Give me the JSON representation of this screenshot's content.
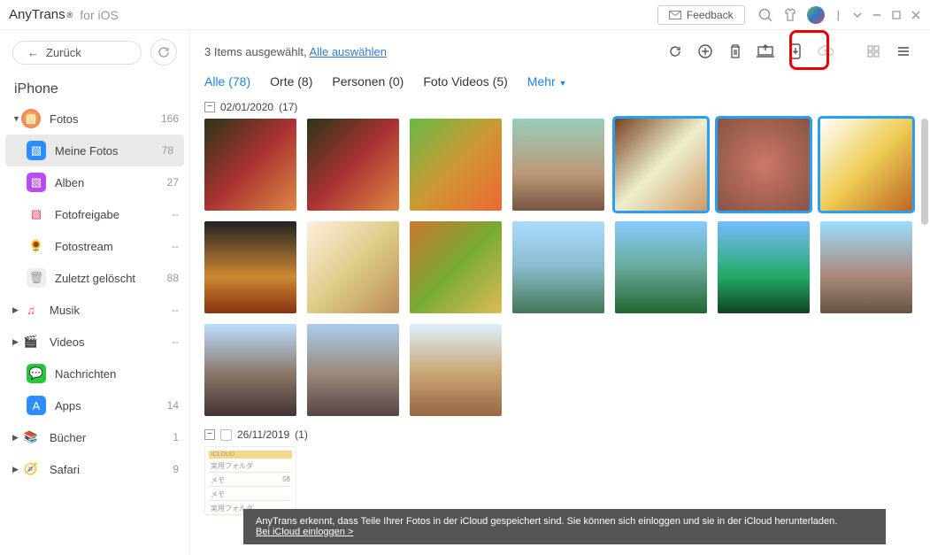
{
  "title": {
    "app": "AnyTrans",
    "suffix": "for iOS"
  },
  "feedback": "Feedback",
  "back": "Zurück",
  "device": "iPhone",
  "sidebar": [
    {
      "label": "Fotos",
      "count": "166",
      "root": true,
      "color": "radial-gradient(circle,#fd5,#e55)",
      "caret": "▼"
    },
    {
      "label": "Meine Fotos",
      "count": "78",
      "child": true,
      "active": true,
      "bg": "#2d8cff"
    },
    {
      "label": "Alben",
      "count": "27",
      "child": true,
      "bg": "#b84cf0"
    },
    {
      "label": "Fotofreigabe",
      "count": "--",
      "child": true,
      "bg": "#fff",
      "fg": "#ff445a"
    },
    {
      "label": "Fotostream",
      "count": "--",
      "child": true,
      "bg": "#fff",
      "emoji": "🌻"
    },
    {
      "label": "Zuletzt gelöscht",
      "count": "88",
      "child": true,
      "bg": "#eee",
      "fg": "#999",
      "emoji": "🗑"
    },
    {
      "label": "Musik",
      "count": "--",
      "root": true,
      "bg": "#fff",
      "fg": "#ff3967",
      "caret": "▶",
      "emoji": "♫"
    },
    {
      "label": "Videos",
      "count": "--",
      "root": true,
      "bg": "#fff",
      "caret": "▶",
      "emoji": "🎬"
    },
    {
      "label": "Nachrichten",
      "count": "",
      "child": true,
      "bg": "#28c53f",
      "emoji": "💬"
    },
    {
      "label": "Apps",
      "count": "14",
      "child": true,
      "bg": "#2d8cff",
      "emoji": "A"
    },
    {
      "label": "Bücher",
      "count": "1",
      "root": true,
      "bg": "#fff",
      "caret": "▶",
      "emoji": "📚"
    },
    {
      "label": "Safari",
      "count": "9",
      "root": true,
      "bg": "#fff",
      "caret": "▶",
      "emoji": "🧭"
    }
  ],
  "selection": {
    "text": "3 Items ausgewählt,",
    "link": "Alle auswählen"
  },
  "tabs": [
    {
      "label": "Alle (78)",
      "active": true
    },
    {
      "label": "Orte (8)"
    },
    {
      "label": "Personen (0)"
    },
    {
      "label": "Foto Videos (5)"
    }
  ],
  "more": "Mehr",
  "groups": [
    {
      "date": "02/01/2020",
      "count": "(17)",
      "thumbs": [
        {
          "g": "linear-gradient(135deg,#2a3618,#a33,#d84)"
        },
        {
          "g": "linear-gradient(135deg,#2a3618,#a33,#d84)"
        },
        {
          "g": "linear-gradient(135deg,#6b4,#c93,#e63)"
        },
        {
          "g": "linear-gradient(180deg,#9cb,#b97 60%,#754)"
        },
        {
          "g": "linear-gradient(135deg,#742,#eec,#c96)",
          "sel": true
        },
        {
          "g": "radial-gradient(circle,#c76,#854)",
          "sel": true
        },
        {
          "g": "linear-gradient(135deg,#fff,#ec5,#b62)",
          "sel": true
        },
        {
          "g": "linear-gradient(180deg,#222,#c83 60%,#831)"
        },
        {
          "g": "linear-gradient(135deg,#fed,#dc8,#b85)"
        },
        {
          "g": "linear-gradient(135deg,#c73,#7a3,#db5)"
        },
        {
          "g": "linear-gradient(180deg,#adf,#8bc 50%,#475)"
        },
        {
          "g": "linear-gradient(180deg,#8cf,#6a9 50%,#263)"
        },
        {
          "g": "linear-gradient(180deg,#7bf,#2a6 60%,#142)"
        },
        {
          "g": "linear-gradient(180deg,#9df,#a87 60%,#654)"
        },
        {
          "g": "linear-gradient(180deg,#bdf,#876 55%,#433)"
        },
        {
          "g": "linear-gradient(180deg,#ace,#987 55%,#544)"
        },
        {
          "g": "linear-gradient(180deg,#def,#ca7 50%,#964)"
        }
      ]
    },
    {
      "date": "26/11/2019",
      "count": "(1)",
      "thumbs": [
        {
          "note": true
        }
      ]
    }
  ],
  "note": {
    "head": "iCLOUD",
    "rows": [
      [
        "実用フォルダ",
        ""
      ],
      [
        "メモ",
        "58"
      ],
      [
        "メモ",
        ""
      ],
      [
        "実用フォルダ",
        ""
      ]
    ]
  },
  "banner": {
    "text": "AnyTrans erkennt, dass Teile Ihrer Fotos in der iCloud gespeichert sind. Sie können sich einloggen und sie in der iCloud herunterladen.",
    "link": "Bei iCloud einloggen >"
  }
}
